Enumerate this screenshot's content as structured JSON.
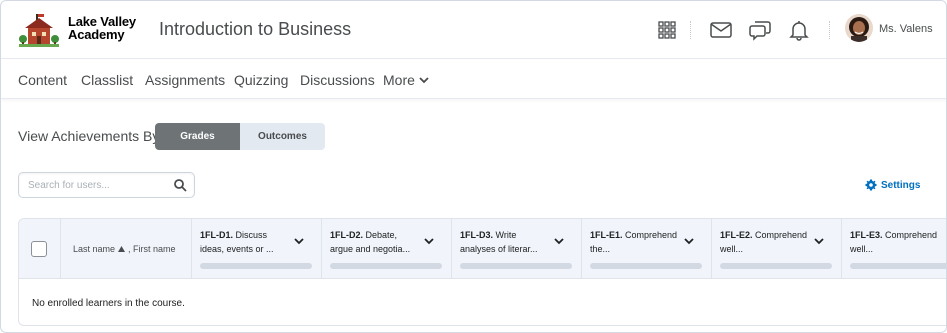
{
  "header": {
    "org_name_line1": "Lake Valley",
    "org_name_line2": "Academy",
    "course_title": "Introduction to Business",
    "icons": [
      "apps-grid-icon",
      "mail-icon",
      "chat-icon",
      "bell-icon"
    ],
    "user_name": "Ms. Valens"
  },
  "nav": {
    "items": [
      "Content",
      "Classlist",
      "Assignments",
      "Quizzing",
      "Discussions"
    ],
    "more_label": "More"
  },
  "view": {
    "label": "View Achievements By:",
    "options": [
      "Grades",
      "Outcomes"
    ],
    "selected": "Grades"
  },
  "search": {
    "placeholder": "Search for users...",
    "value": ""
  },
  "settings_label": "Settings",
  "table": {
    "name_header": "Last name ▲, First name",
    "name_header_sort": "Last name",
    "name_header_rest": ", First name",
    "columns": [
      {
        "code": "1FL-D1.",
        "text": "Discuss ideas, events or ..."
      },
      {
        "code": "1FL-D2.",
        "text": "Debate, argue and negotia..."
      },
      {
        "code": "1FL-D3.",
        "text": "Write analyses of literar..."
      },
      {
        "code": "1FL-E1.",
        "text": "Comprehend the..."
      },
      {
        "code": "1FL-E2.",
        "text": "Comprehend well..."
      },
      {
        "code": "1FL-E3.",
        "text": "Comprehend well..."
      }
    ],
    "empty_message": "No enrolled learners in the course."
  },
  "colors": {
    "accent_link": "#006fbf",
    "segment_selected": "#6e7376",
    "segment_unselected": "#e3e9f1",
    "header_bg": "#f1f5fb"
  }
}
